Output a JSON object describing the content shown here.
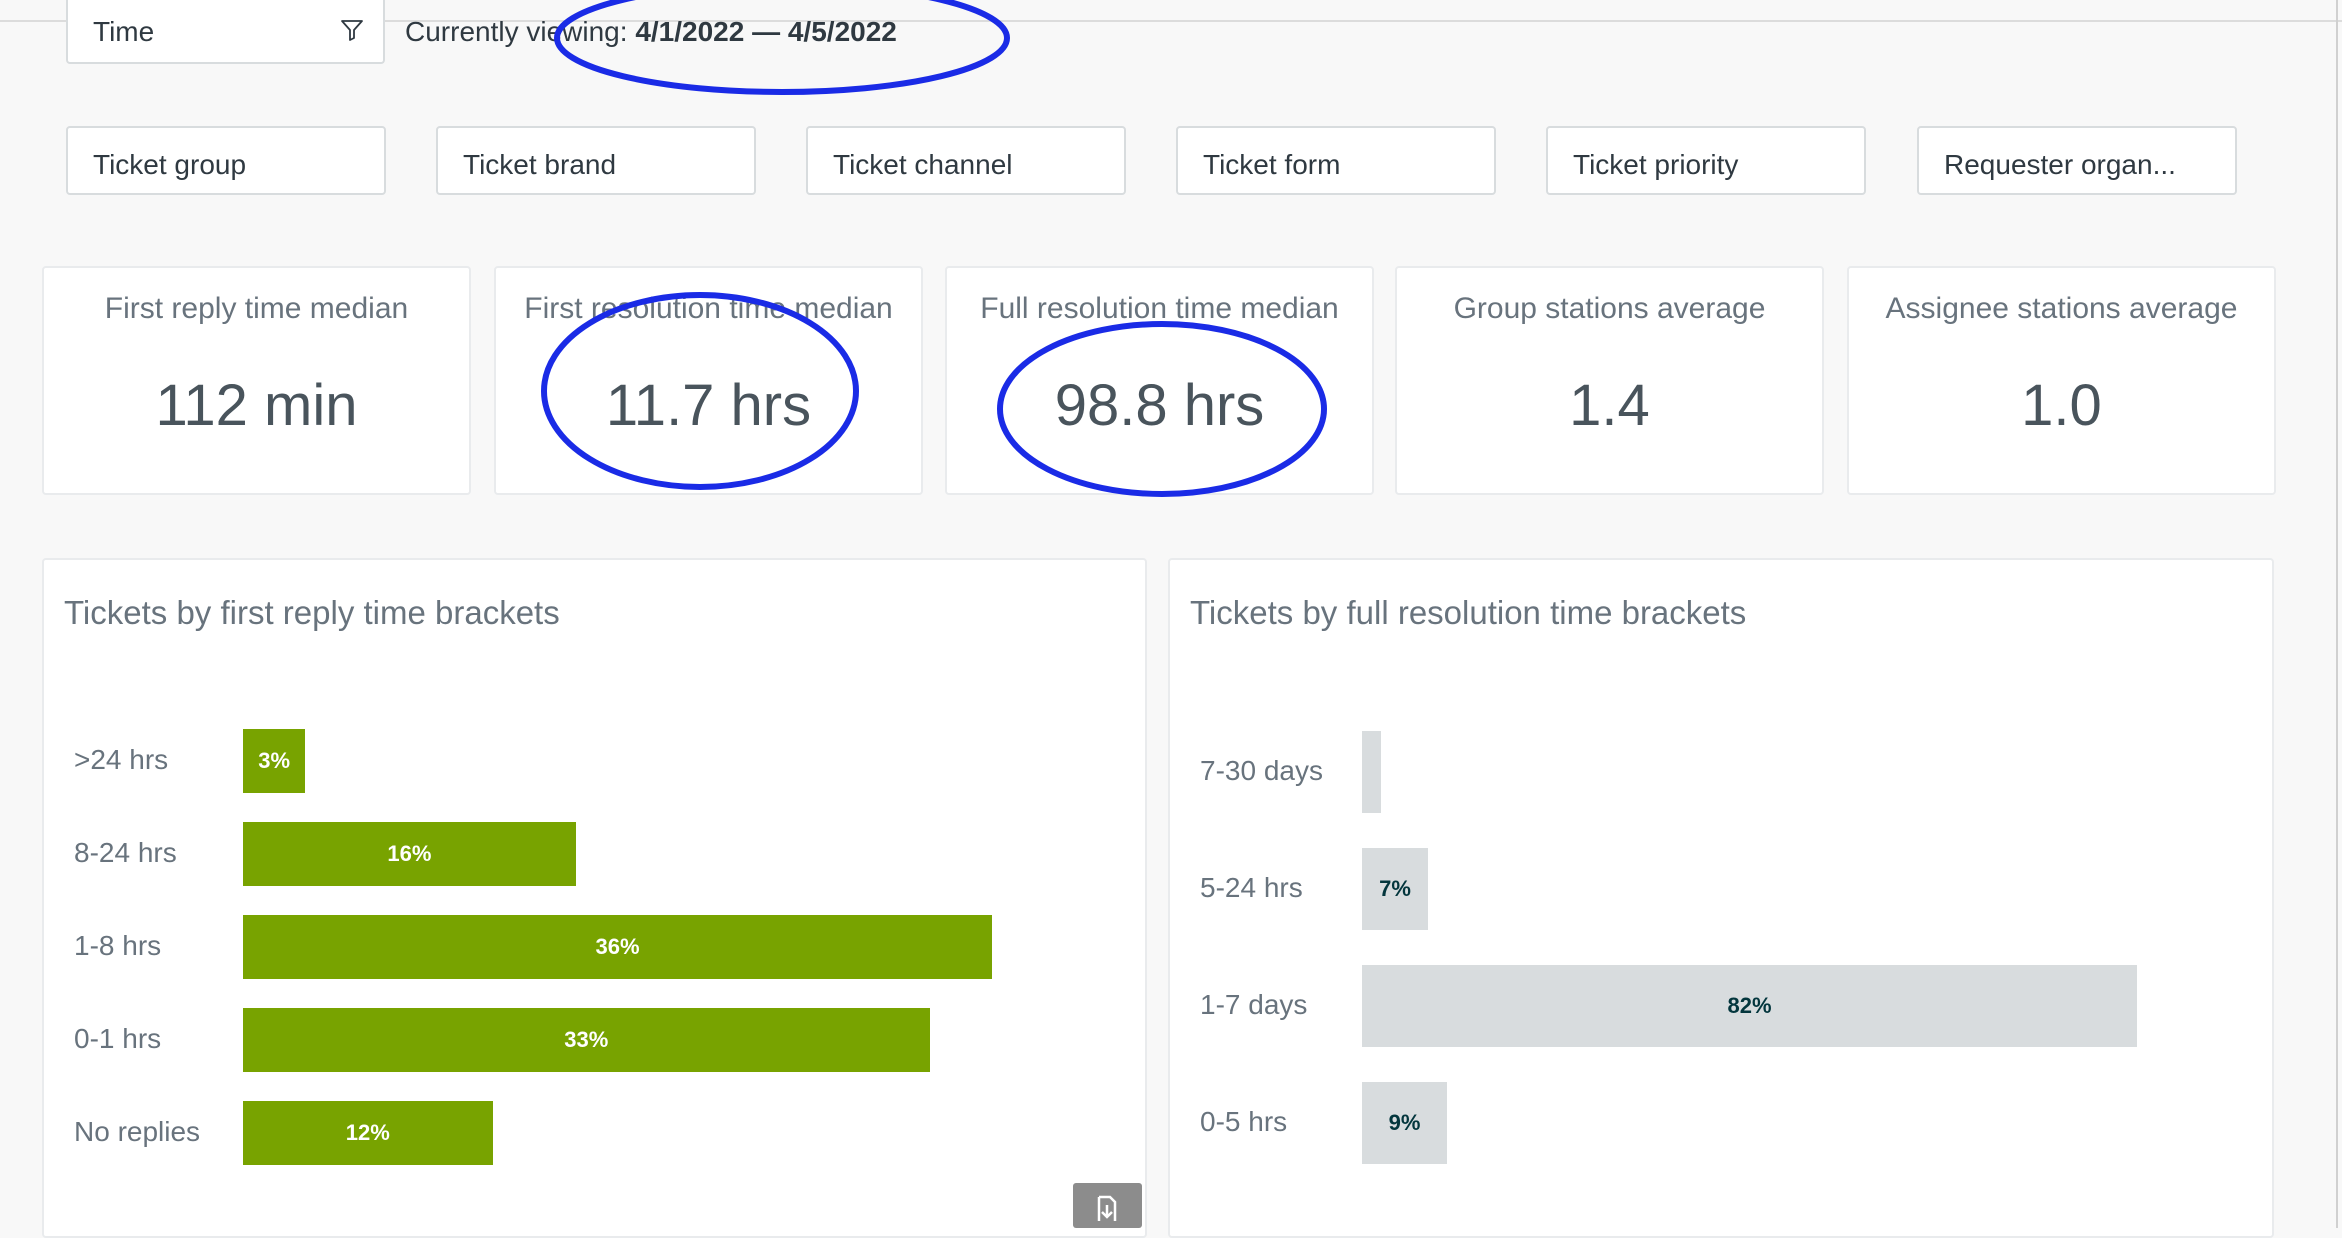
{
  "time_filter": {
    "label": "Time",
    "icon": "filter-icon"
  },
  "viewing": {
    "prefix": "Currently viewing: ",
    "range": "4/1/2022 — 4/5/2022"
  },
  "filters": [
    "Ticket group",
    "Ticket brand",
    "Ticket channel",
    "Ticket form",
    "Ticket priority",
    "Requester organ..."
  ],
  "kpis": [
    {
      "title": "First reply time median",
      "value": "112 min"
    },
    {
      "title": "First resolution time median",
      "value": "11.7 hrs"
    },
    {
      "title": "Full resolution time median",
      "value": "98.8 hrs"
    },
    {
      "title": "Group stations average",
      "value": "1.4"
    },
    {
      "title": "Assignee stations average",
      "value": "1.0"
    }
  ],
  "colors": {
    "green_bar": "#78a300",
    "grey_bar": "#d8dcde",
    "annotation": "#1a2be6"
  },
  "chart_data": [
    {
      "type": "bar",
      "orientation": "horizontal",
      "title": "Tickets by first reply time brackets",
      "categories": [
        ">24 hrs",
        "8-24 hrs",
        "1-8 hrs",
        "0-1 hrs",
        "No replies"
      ],
      "values": [
        3,
        16,
        36,
        33,
        12
      ],
      "labels": [
        "3%",
        "16%",
        "36%",
        "33%",
        "12%"
      ],
      "unit": "%",
      "xlim": [
        0,
        36
      ],
      "color": "#78a300"
    },
    {
      "type": "bar",
      "orientation": "horizontal",
      "title": "Tickets by full resolution time brackets",
      "categories": [
        "7-30 days",
        "5-24 hrs",
        "1-7 days",
        "0-5 hrs"
      ],
      "values": [
        2,
        7,
        82,
        9
      ],
      "labels": [
        "",
        "7%",
        "82%",
        "9%"
      ],
      "unit": "%",
      "xlim": [
        0,
        82
      ],
      "color": "#d8dcde"
    }
  ],
  "download_icon": "download-icon"
}
